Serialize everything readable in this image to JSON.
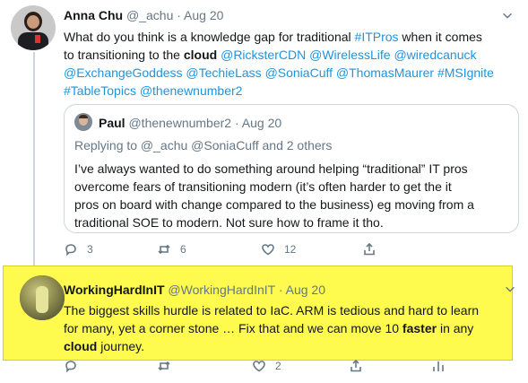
{
  "tweet1": {
    "name": "Anna Chu",
    "handle": "@_achu",
    "sep": "·",
    "date": "Aug 20",
    "text": {
      "l1a": "What do you think is a knowledge gap for traditional ",
      "l1tag": "#ITPros",
      "l1b": " when it comes",
      "l2a": "to transitioning to the ",
      "l2b": "cloud",
      "l2c": " ",
      "m1": "@RicksterCDN",
      "m2": "@WirelessLife",
      "m3": "@wiredcanuck",
      "m4": "@ExchangeGoddess",
      "m5": "@TechieLass",
      "m6": "@SoniaCuff",
      "m7": "@ThomasMaurer",
      "m8": "#MSIgnite",
      "m9": "#TableTopics",
      "m10": "@thenewnumber2"
    },
    "quote": {
      "name": "Paul",
      "handle": "@thenewnumber2",
      "sep": "·",
      "date": "Aug 20",
      "reply_to": "Replying to @_achu @SoniaCuff and 2 others",
      "lines": [
        "I’ve always wanted to do something around helping “traditional” IT pros",
        "overcome fears of transitioning modern (it’s often harder to get the it",
        "pros on board with change compared to the business) eg moving from a",
        "traditional SOE to modern.  Not sure how to frame it tho."
      ]
    },
    "actions": {
      "reply_count": "3",
      "retweet_count": "6",
      "like_count": "12"
    }
  },
  "tweet2": {
    "name": "WorkingHardInIT",
    "handle": "@WorkingHardInIT",
    "sep": "·",
    "date": "Aug 20",
    "text": {
      "l1": "The biggest skills hurdle is related to IaC. ARM is tedious and hard to learn",
      "l2": "for many, yet a corner stone … Fix that and we can move 10 ",
      "l2b": "faster",
      "l2c": " in any",
      "l3a": "cloud",
      "l3b": " journey."
    },
    "actions": {
      "like_count": "2"
    }
  },
  "colors": {
    "link": "#1b95e0",
    "highlight": "#fefb4e",
    "muted": "#657786",
    "border": "#ccd6dd"
  }
}
